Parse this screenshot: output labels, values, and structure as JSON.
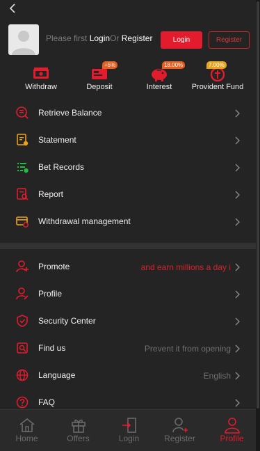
{
  "header": {
    "back_icon": "chevron-left-icon"
  },
  "user": {
    "prompt_prefix": "Please first",
    "login_link": "Login",
    "or": "Or",
    "register_link": "Register",
    "login_button": "Login",
    "register_button": "Register"
  },
  "quick_actions": [
    {
      "label": "Withdraw",
      "icon": "withdraw-icon"
    },
    {
      "label": "Deposit",
      "icon": "deposit-icon",
      "badge": "+5%"
    },
    {
      "label": "Interest",
      "icon": "piggy-bank-icon",
      "badge": "18.00%"
    },
    {
      "label": "Provident Fund",
      "icon": "fund-icon",
      "badge": "7.00%"
    }
  ],
  "menu_primary": [
    {
      "label": "Retrieve Balance",
      "icon": "retrieve-icon"
    },
    {
      "label": "Statement",
      "icon": "statement-icon"
    },
    {
      "label": "Bet Records",
      "icon": "bet-records-icon"
    },
    {
      "label": "Report",
      "icon": "report-icon"
    },
    {
      "label": "Withdrawal management",
      "icon": "withdrawal-management-icon"
    }
  ],
  "menu_secondary": [
    {
      "label": "Promote",
      "value": "and earn millions a day i",
      "icon": "promote-icon"
    },
    {
      "label": "Profile",
      "value": "",
      "icon": "profile-icon"
    },
    {
      "label": "Security Center",
      "value": "",
      "icon": "shield-icon"
    },
    {
      "label": "Find us",
      "value": "Prevent it from opening",
      "icon": "find-us-icon"
    },
    {
      "label": "Language",
      "value": "English",
      "icon": "globe-icon"
    },
    {
      "label": "FAQ",
      "value": "",
      "icon": "question-icon"
    }
  ],
  "tabbar": [
    {
      "label": "Home",
      "icon": "home-icon"
    },
    {
      "label": "Offers",
      "icon": "gift-icon"
    },
    {
      "label": "Login",
      "icon": "login-icon"
    },
    {
      "label": "Register",
      "icon": "register-icon"
    },
    {
      "label": "Profile",
      "icon": "profile-tab-icon",
      "active": true
    }
  ],
  "colors": {
    "accent": "#e21c2c",
    "background": "#242424",
    "text": "#f0f0f0",
    "muted": "#6f6f6f"
  }
}
